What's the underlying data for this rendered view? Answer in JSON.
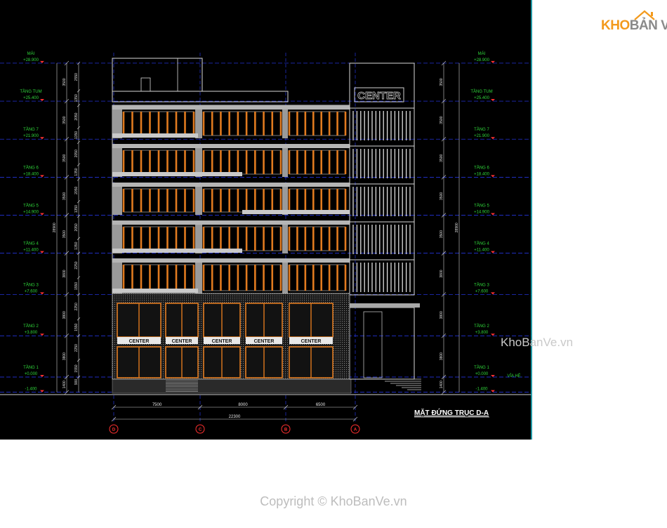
{
  "drawing_title": "MẶT ĐỨNG TRỤC D-A",
  "levels": [
    {
      "name": "MÁI",
      "elev": "+28.900"
    },
    {
      "name": "TẦNG TUM",
      "elev": "+25.400"
    },
    {
      "name": "TẦNG 7",
      "elev": "+21.900"
    },
    {
      "name": "TẦNG 6",
      "elev": "+18.400"
    },
    {
      "name": "TẦNG 5",
      "elev": "+14.900"
    },
    {
      "name": "TẦNG 4",
      "elev": "+11.400"
    },
    {
      "name": "TẦNG 3",
      "elev": "+7.600"
    },
    {
      "name": "TẦNG 2",
      "elev": "+3.800"
    },
    {
      "name": "TẦNG 1",
      "elev": "+0.000"
    },
    {
      "name": "",
      "elev": "-1.400"
    }
  ],
  "via_he_label": "VỈA HÈ",
  "left_dims": [
    "3500",
    "3500",
    "3500",
    "3500",
    "3500",
    "3800",
    "3800",
    "3800",
    "1400"
  ],
  "left_total": "28900",
  "right_dims": [
    "3500",
    "3500",
    "3500",
    "3500",
    "3500",
    "3800",
    "3800",
    "3800",
    "1400"
  ],
  "right_total": "28900",
  "inner_dims": [
    "2550",
    "1350",
    "2050",
    "1350",
    "2050",
    "1350",
    "2050",
    "1350",
    "2050",
    "1350",
    "2250",
    "1550",
    "2250",
    "1550",
    "2250",
    "1550",
    "900"
  ],
  "bottom_dims": [
    "7500",
    "8000",
    "6500"
  ],
  "bottom_total": "22300",
  "axes": [
    "D",
    "C",
    "B",
    "A"
  ],
  "sign_text": "CENTER",
  "logo": {
    "part1": "KHO",
    "part2": "BẢN VẼ"
  },
  "watermark": "KhoBanVe.vn",
  "copyright": "Copyright © KhoBanVe.vn",
  "colors": {
    "background": "#000000",
    "level_text": "#2fd53a",
    "axis_marker": "#ff3030",
    "grid_line": "#2a3cff",
    "window_frame": "#e07a1f",
    "logo_orange": "#f39a1c"
  }
}
